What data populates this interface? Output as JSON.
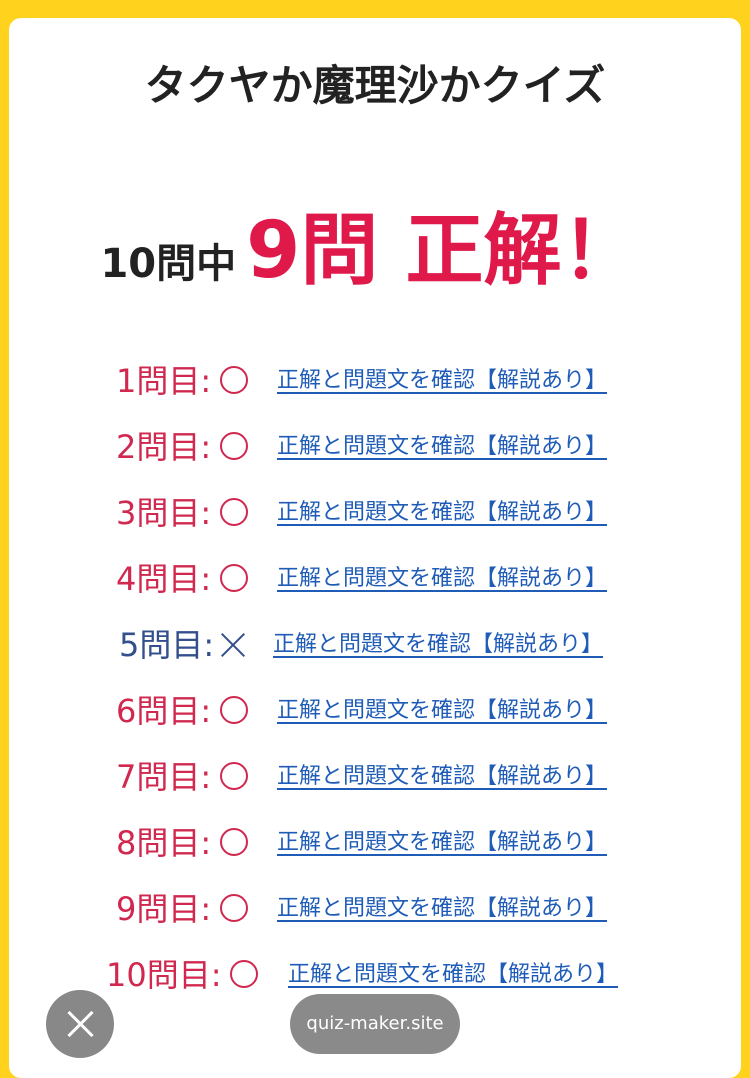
{
  "quiz": {
    "title": "タクヤか魔理沙かクイズ"
  },
  "score": {
    "total_text": "10問中",
    "correct_text": "9問 正解！"
  },
  "results": [
    {
      "label": "1問目:",
      "mark": "circle",
      "link": "正解と問題文を確認【解説あり】"
    },
    {
      "label": "2問目:",
      "mark": "circle",
      "link": "正解と問題文を確認【解説あり】"
    },
    {
      "label": "3問目:",
      "mark": "circle",
      "link": "正解と問題文を確認【解説あり】"
    },
    {
      "label": "4問目:",
      "mark": "circle",
      "link": "正解と問題文を確認【解説あり】"
    },
    {
      "label": "5問目:",
      "mark": "cross",
      "link": "正解と問題文を確認【解説あり】"
    },
    {
      "label": "6問目:",
      "mark": "circle",
      "link": "正解と問題文を確認【解説あり】"
    },
    {
      "label": "7問目:",
      "mark": "circle",
      "link": "正解と問題文を確認【解説あり】"
    },
    {
      "label": "8問目:",
      "mark": "circle",
      "link": "正解と問題文を確認【解説あり】"
    },
    {
      "label": "9問目:",
      "mark": "circle",
      "link": "正解と問題文を確認【解説あり】"
    },
    {
      "label": "10問目:",
      "mark": "circle",
      "link": "正解と問題文を確認【解説あり】"
    }
  ],
  "footer": {
    "site_label": "quiz-maker.site",
    "close_icon": "close-icon"
  },
  "colors": {
    "frame": "#FFD21E",
    "correct": "#D0284F",
    "wrong": "#33508C",
    "score_highlight": "#E0194B",
    "link": "#1F5CB8"
  }
}
